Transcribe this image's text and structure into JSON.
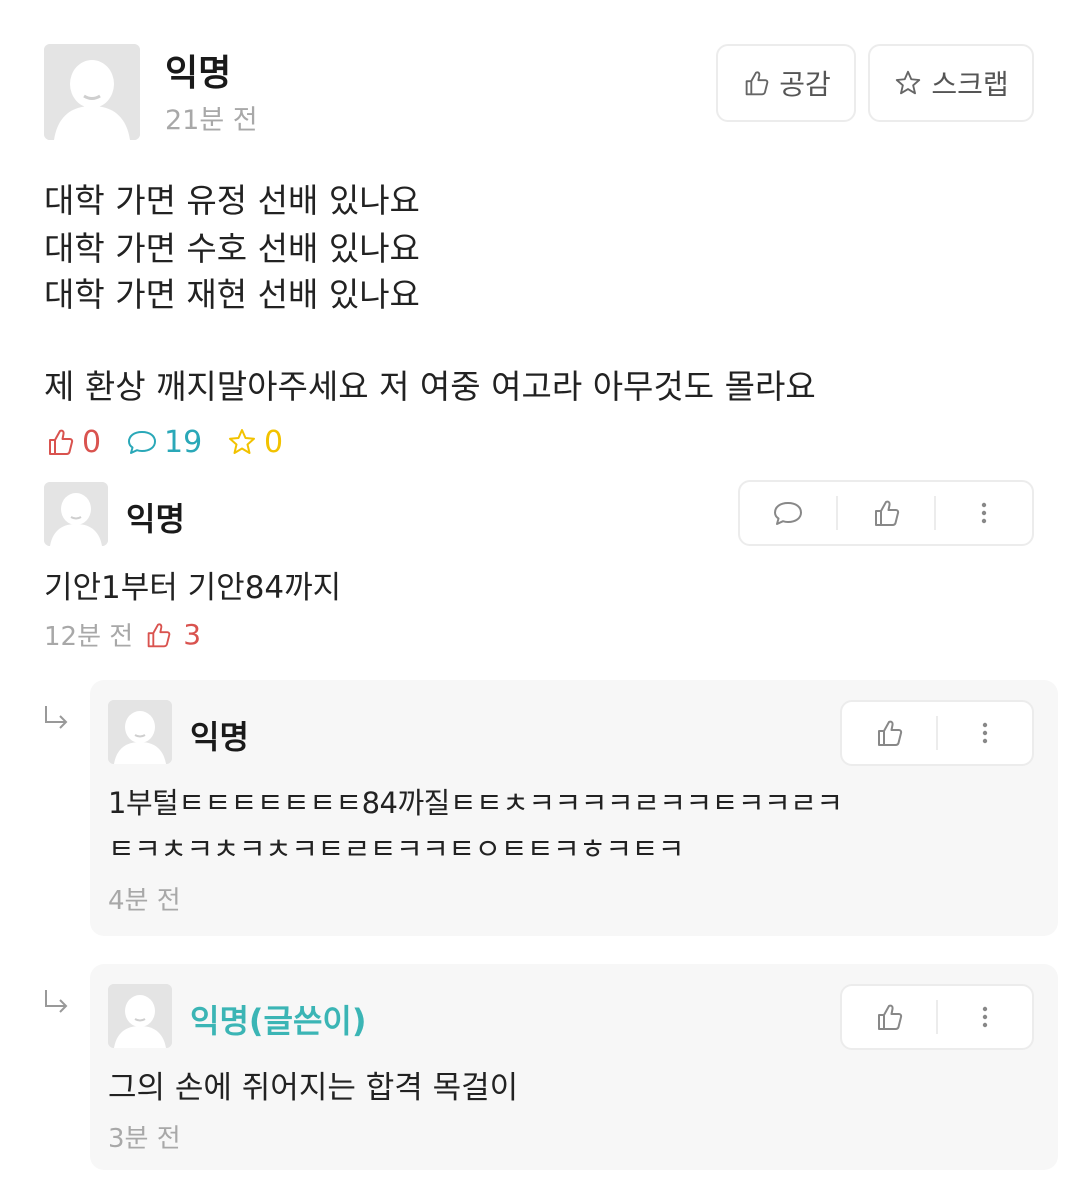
{
  "post": {
    "author": "익명",
    "time": "21분 전",
    "like_button_label": "공감",
    "scrap_button_label": "스크랩",
    "lines": [
      "대학 가면 유정 선배 있나요",
      "대학 가면 수호 선배 있나요",
      "대학 가면 재현 선배 있나요",
      "",
      "제 환상 깨지말아주세요 저 여중 여고라 아무것도 몰라요"
    ],
    "stats": {
      "likes": "0",
      "comments": "19",
      "scraps": "0"
    }
  },
  "comments": [
    {
      "author": "익명",
      "text": "기안1부터 기안84까지",
      "time": "12분 전",
      "likes": "3",
      "is_reply": false
    },
    {
      "author": "익명",
      "text_lines": [
        "1부털ㅌㅌㅌㅌㅌㅌㅌ84까질ㅌㅌㅊㅋㅋㅋㅋㄹㅋㅋㅌㅋㅋㄹㅋ",
        "ㅌㅋㅊㅋㅊㅋㅊㅋㅌㄹㅌㅋㅋㅌㅇㅌㅌㅋㅎㅋㅌㅋ"
      ],
      "time": "4분 전",
      "is_reply": true
    },
    {
      "author": "익명(글쓴이)",
      "text": "그의 손에 쥐어지는 합격 목걸이",
      "time": "3분 전",
      "is_reply": true
    }
  ],
  "icons": {
    "thumb": "thumbs-up-icon",
    "star": "star-icon",
    "bubble": "speech-bubble-icon",
    "more": "more-vertical-icon",
    "reply": "reply-arrow-icon"
  },
  "colors": {
    "like_accent": "#d9534f",
    "comment_accent": "#2aa8b8",
    "scrap_accent": "#f2c200",
    "op_author": "#3bb5b5",
    "muted_text": "#a8a8a8"
  }
}
